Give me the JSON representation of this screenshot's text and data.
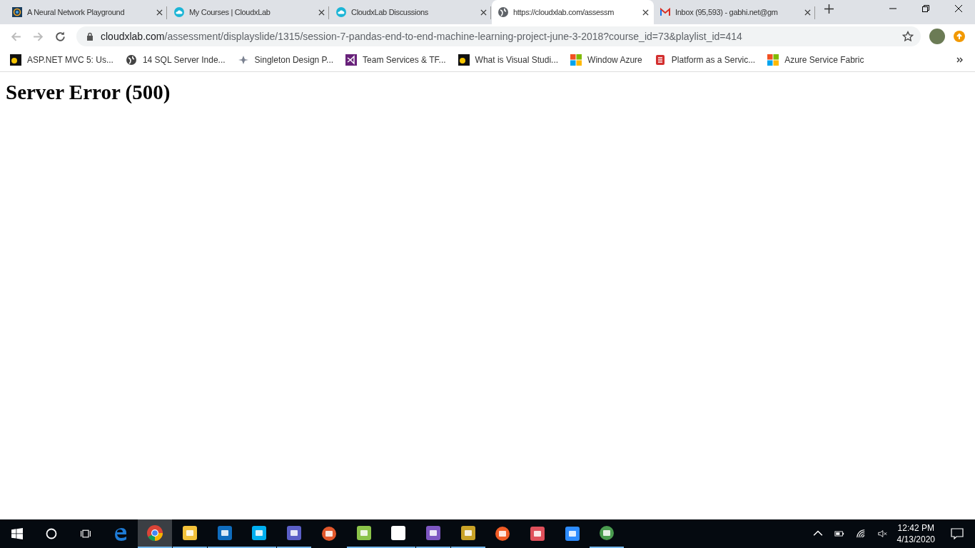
{
  "tabs": [
    {
      "title": "A Neural Network Playground",
      "kind": "spiral",
      "selected": false
    },
    {
      "title": "My Courses | CloudxLab",
      "kind": "cloud",
      "selected": false
    },
    {
      "title": "CloudxLab Discussions",
      "kind": "chat",
      "selected": false
    },
    {
      "title": "https://cloudxlab.com/assessm",
      "kind": "globe",
      "selected": true
    },
    {
      "title": "Inbox (95,593) - gabhi.net@gm",
      "kind": "mail",
      "selected": false
    }
  ],
  "address": {
    "host": "cloudxlab.com",
    "path": "/assessment/displayslide/1315/session-7-pandas-end-to-end-machine-learning-project-june-3-2018?course_id=73&playlist_id=414"
  },
  "bookmarks": [
    {
      "label": "ASP.NET MVC 5: Us...",
      "kind": "dark"
    },
    {
      "label": "14 SQL Server Inde...",
      "kind": "globe"
    },
    {
      "label": "Singleton Design P...",
      "kind": "star"
    },
    {
      "label": "Team Services & TF...",
      "kind": "vs"
    },
    {
      "label": "What is Visual Studi...",
      "kind": "dark"
    },
    {
      "label": "Window Azure",
      "kind": "ms"
    },
    {
      "label": "Platform as a Servic...",
      "kind": "doc"
    },
    {
      "label": "Azure Service Fabric",
      "kind": "ms"
    }
  ],
  "page": {
    "heading": "Server Error (500)"
  },
  "taskbar": {
    "apps": [
      {
        "kind": "edge",
        "running": false,
        "selected": false
      },
      {
        "kind": "chrome",
        "running": true,
        "selected": true
      },
      {
        "kind": "folder",
        "running": true,
        "selected": false
      },
      {
        "kind": "outlook",
        "running": true,
        "selected": false
      },
      {
        "kind": "skype",
        "running": true,
        "selected": false
      },
      {
        "kind": "teams",
        "running": true,
        "selected": false
      },
      {
        "kind": "hub",
        "running": false,
        "selected": false
      },
      {
        "kind": "notepad",
        "running": true,
        "selected": false
      },
      {
        "kind": "sticky",
        "running": true,
        "selected": false
      },
      {
        "kind": "vs",
        "running": true,
        "selected": false
      },
      {
        "kind": "tools",
        "running": true,
        "selected": false
      },
      {
        "kind": "postman",
        "running": false,
        "selected": false
      },
      {
        "kind": "snip",
        "running": false,
        "selected": false
      },
      {
        "kind": "zoom",
        "running": false,
        "selected": false
      },
      {
        "kind": "cisco",
        "running": true,
        "selected": false
      }
    ],
    "time": "12:42 PM",
    "date": "4/13/2020"
  }
}
